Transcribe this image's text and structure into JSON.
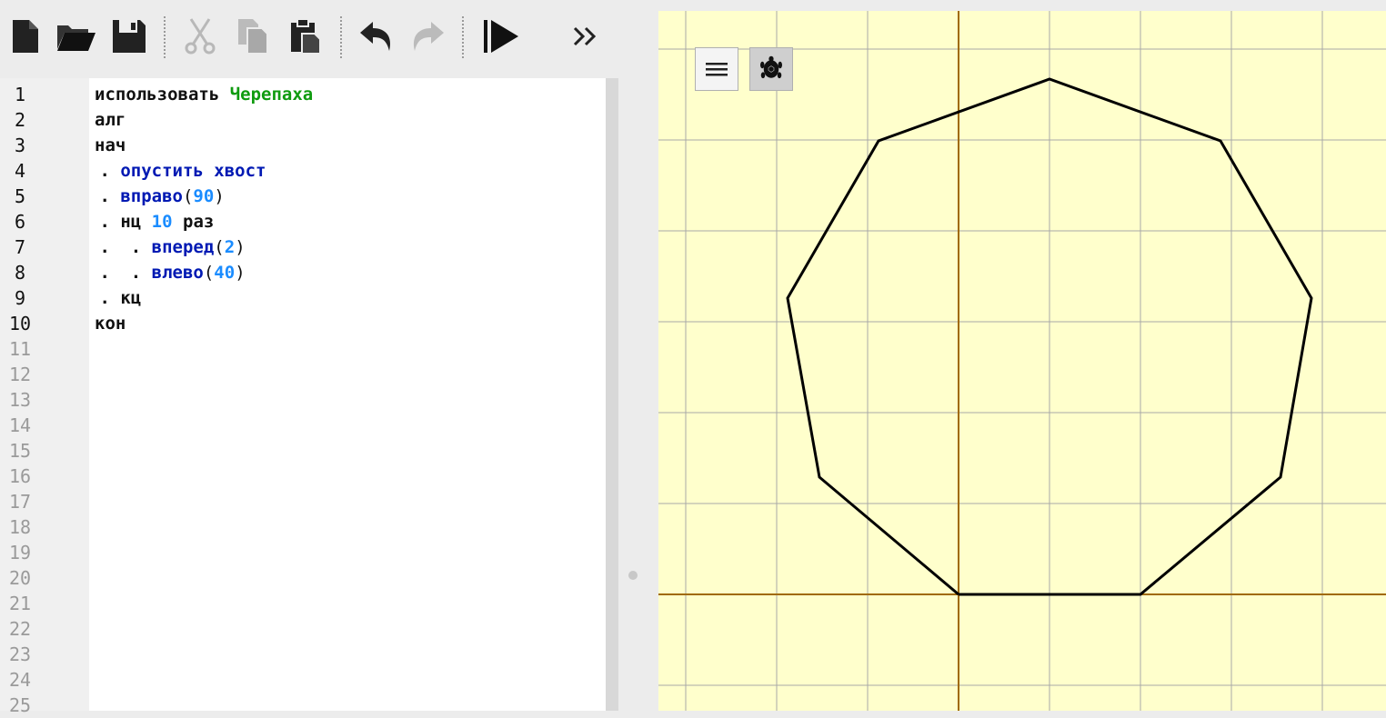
{
  "toolbar": {
    "buttons": [
      {
        "id": "new",
        "icon": "new-file-icon"
      },
      {
        "id": "open",
        "icon": "open-folder-icon"
      },
      {
        "id": "save",
        "icon": "save-icon"
      },
      {
        "id": "cut",
        "icon": "cut-icon"
      },
      {
        "id": "copy",
        "icon": "copy-icon"
      },
      {
        "id": "paste",
        "icon": "paste-icon"
      },
      {
        "id": "undo",
        "icon": "undo-icon"
      },
      {
        "id": "redo",
        "icon": "redo-icon"
      },
      {
        "id": "run",
        "icon": "run-icon"
      },
      {
        "id": "more",
        "icon": "double-chevron-right-icon"
      }
    ]
  },
  "editor": {
    "line_numbers": [
      "1",
      "2",
      "3",
      "4",
      "5",
      "6",
      "7",
      "8",
      "9",
      "10",
      "11",
      "12",
      "13",
      "14",
      "15",
      "16",
      "17",
      "18",
      "19",
      "20",
      "21",
      "22",
      "23",
      "24",
      "25"
    ],
    "line_count_active": 10,
    "code": {
      "l1": {
        "kw": "использовать",
        "mod": "Черепаха"
      },
      "l2": {
        "kw": "алг"
      },
      "l3": {
        "kw": "нач"
      },
      "l4": {
        "dot": " . ",
        "fn": "опустить хвост"
      },
      "l5": {
        "dot": " . ",
        "fn": "вправо",
        "open": "(",
        "num": "90",
        "close": ")"
      },
      "l6": {
        "dot": " . ",
        "kw": "нц",
        "num": "10",
        "kw2": "раз"
      },
      "l7": {
        "dot": " .  . ",
        "fn": "вперед",
        "open": "(",
        "num": "2",
        "close": ")"
      },
      "l8": {
        "dot": " .  . ",
        "fn": "влево",
        "open": "(",
        "num": "40",
        "close": ")"
      },
      "l9": {
        "dot": " . ",
        "kw": "кц"
      },
      "l10": {
        "kw": "кон"
      }
    }
  },
  "canvas": {
    "buttons": [
      {
        "id": "menu",
        "icon": "hamburger-menu-icon"
      },
      {
        "id": "turtle",
        "icon": "turtle-icon"
      }
    ],
    "colors": {
      "background": "#ffffcc",
      "grid": "#a8a8a8",
      "axis": "#a06a00",
      "path": "#000000"
    }
  }
}
